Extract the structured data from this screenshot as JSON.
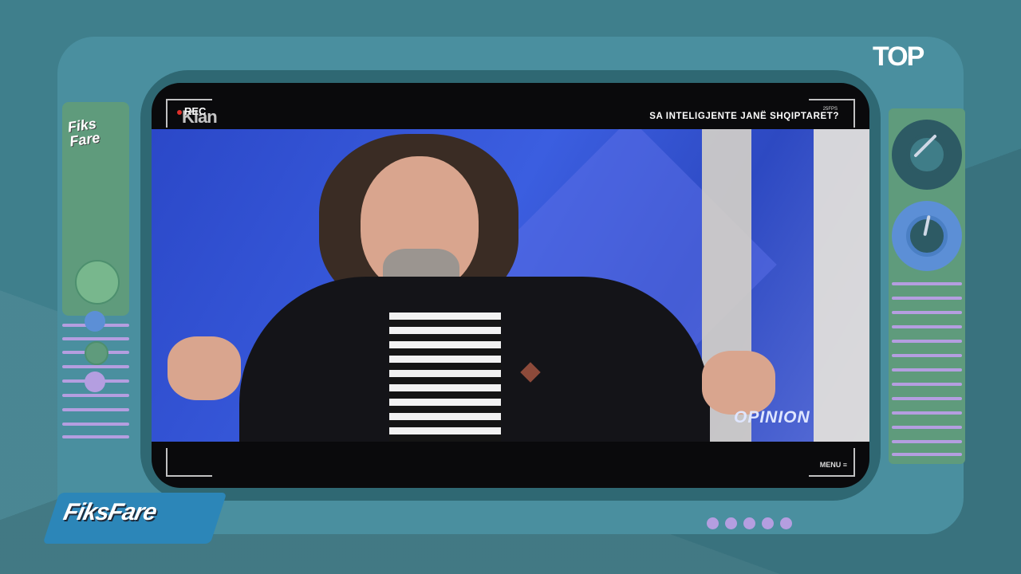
{
  "overlay": {
    "rec_label": "REC",
    "channel": "Klan",
    "headline": "SA INTELIGJENTE JANË SHQIPTARET?",
    "rec_meta": "25FPS",
    "menu_label": "MENU"
  },
  "studio": {
    "show_logo": "OPINION"
  },
  "brand": {
    "show_name": "FiksFare",
    "mini_logo_line1": "Fiks",
    "mini_logo_line2": "Fare",
    "network_logo": "TOP"
  },
  "colors": {
    "background": "#3f7f8c",
    "tv_body": "#4a8f9f",
    "panel_green": "#5f9b7c",
    "accent_lavender": "#b49ee0",
    "dial_blue": "#5c8fd6",
    "studio_blue": "#3b5ee0"
  },
  "page_dots": 5
}
